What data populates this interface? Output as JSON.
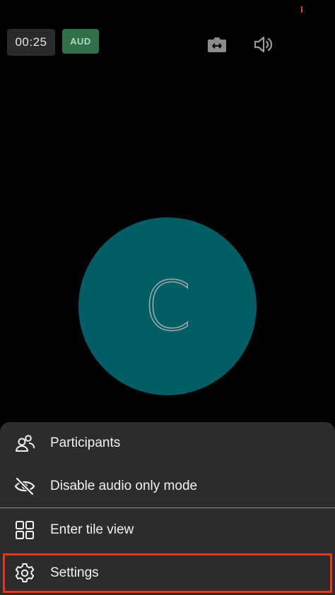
{
  "call": {
    "timer": "00:25",
    "audio_badge": "AUD",
    "avatar_initial": "C"
  },
  "toolbar": {
    "icons": [
      "flip-camera-icon",
      "speaker-icon"
    ]
  },
  "menu": {
    "items": [
      {
        "label": "Participants",
        "icon": "participants-icon"
      },
      {
        "label": "Disable audio only mode",
        "icon": "eye-off-icon"
      },
      {
        "label": "Enter tile view",
        "icon": "tile-view-icon"
      },
      {
        "label": "Settings",
        "icon": "gear-icon"
      }
    ],
    "highlighted": "Settings"
  },
  "colors": {
    "background": "#000000",
    "avatar": "#015e67",
    "audio_badge": "#2f6f4a",
    "sheet": "#2c2c2c",
    "highlight": "#e8351c"
  }
}
